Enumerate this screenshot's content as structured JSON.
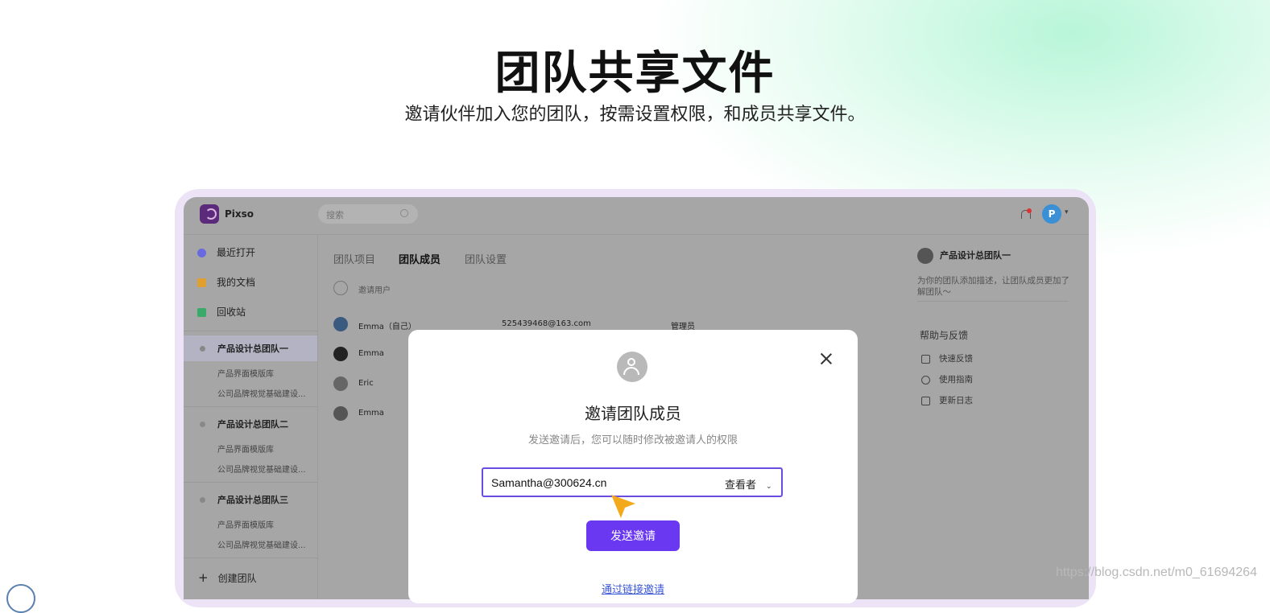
{
  "hero": {
    "title": "团队共享文件",
    "subtitle": "邀请伙伴加入您的团队，按需设置权限，和成员共享文件。"
  },
  "app": {
    "brand": "Pixso",
    "search": {
      "placeholder": "搜索"
    },
    "avatar_letter": "P",
    "colors": {
      "accent": "#6a38f0",
      "avatar": "#3a8fd5",
      "notification": "#dd3333"
    }
  },
  "sidebar": {
    "items": [
      {
        "label": "最近打开",
        "icon": "clock-icon",
        "color": "#6a6ae0"
      },
      {
        "label": "我的文档",
        "icon": "document-icon",
        "color": "#e0a030"
      },
      {
        "label": "回收站",
        "icon": "trash-icon",
        "color": "#3aaa6a"
      }
    ],
    "teams": [
      {
        "name": "产品设计总团队一",
        "children": [
          "产品界面模版库",
          "公司品牌视觉基础建设..."
        ]
      },
      {
        "name": "产品设计总团队二",
        "children": [
          "产品界面模版库",
          "公司品牌视觉基础建设..."
        ]
      },
      {
        "name": "产品设计总团队三",
        "children": [
          "产品界面模版库",
          "公司品牌视觉基础建设..."
        ]
      }
    ],
    "create_team": "创建团队"
  },
  "main": {
    "tabs": [
      "团队项目",
      "团队成员",
      "团队设置"
    ],
    "invite_user": "邀请用户",
    "members": [
      {
        "name": "Emma（自己）",
        "email": "525439468@163.com",
        "role": "管理员"
      },
      {
        "name": "Emma"
      },
      {
        "name": "Eric"
      },
      {
        "name": "Emma"
      }
    ]
  },
  "right_panel": {
    "team_name": "产品设计总团队一",
    "description": "为你的团队添加描述，让团队成员更加了解团队～",
    "help_title": "帮助与反馈",
    "links": [
      {
        "label": "快速反馈",
        "icon": "feedback-icon"
      },
      {
        "label": "使用指南",
        "icon": "help-icon"
      },
      {
        "label": "更新日志",
        "icon": "clipboard-icon"
      }
    ]
  },
  "modal": {
    "title": "邀请团队成员",
    "description": "发送邀请后，您可以随时修改被邀请人的权限",
    "email_value": "Samantha@300624.cn",
    "role": "查看者",
    "send_label": "发送邀请",
    "link_invite": "通过链接邀请"
  },
  "watermark": "https://blog.csdn.net/m0_61694264"
}
